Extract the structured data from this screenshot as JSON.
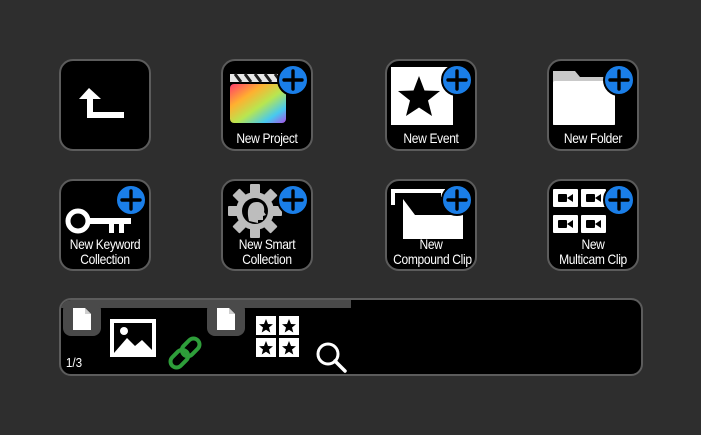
{
  "tiles": {
    "back": {
      "icon": "return-arrow-icon"
    },
    "new_project": {
      "label": "New Project",
      "icon": "clapperboard-icon"
    },
    "new_event": {
      "label": "New Event",
      "icon": "star-icon"
    },
    "new_folder": {
      "label": "New Folder",
      "icon": "folder-icon"
    },
    "new_keyword_collection": {
      "label_line1": "New Keyword",
      "label_line2": "Collection",
      "icon": "key-icon"
    },
    "new_smart_collection": {
      "label_line1": "New Smart",
      "label_line2": "Collection",
      "icon": "gear-head-icon"
    },
    "new_compound_clip": {
      "label_line1": "New",
      "label_line2": "Compound Clip",
      "icon": "compound-clip-icon"
    },
    "new_multicam_clip": {
      "label_line1": "New",
      "label_line2": "Multicam Clip",
      "icon": "camera-grid-icon"
    }
  },
  "bottom_bar": {
    "page_counter": "1/3",
    "items": [
      "document-icon",
      "image-icon",
      "link-icon",
      "document-icon",
      "star-grid-icon",
      "search-icon"
    ]
  },
  "colors": {
    "background": "#2e2e2e",
    "tile": "#000000",
    "border": "#5c5c5c",
    "plus_badge": "#1a7ee8",
    "link": "#2e9e3a"
  }
}
